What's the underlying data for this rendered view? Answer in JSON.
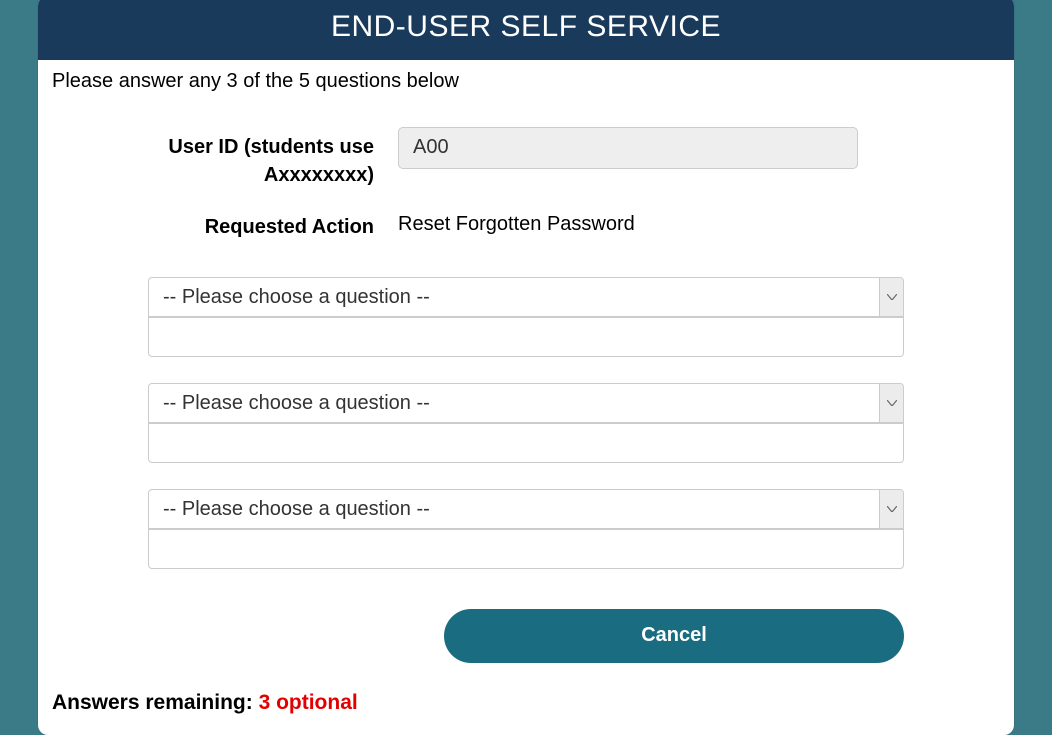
{
  "header": {
    "title": "END-USER SELF SERVICE"
  },
  "instruction": "Please answer any 3 of the 5 questions below",
  "form": {
    "userIdLabel": "User ID (students use Axxxxxxxx)",
    "userIdValue": "A00",
    "actionLabel": "Requested Action",
    "actionValue": "Reset Forgotten Password"
  },
  "questions": {
    "placeholder": "-- Please choose a question --",
    "items": [
      {
        "selected": "-- Please choose a question --",
        "answer": ""
      },
      {
        "selected": "-- Please choose a question --",
        "answer": ""
      },
      {
        "selected": "-- Please choose a question --",
        "answer": ""
      }
    ]
  },
  "buttons": {
    "cancel": "Cancel"
  },
  "footer": {
    "label": "Answers remaining: ",
    "remaining": "3 optional"
  }
}
